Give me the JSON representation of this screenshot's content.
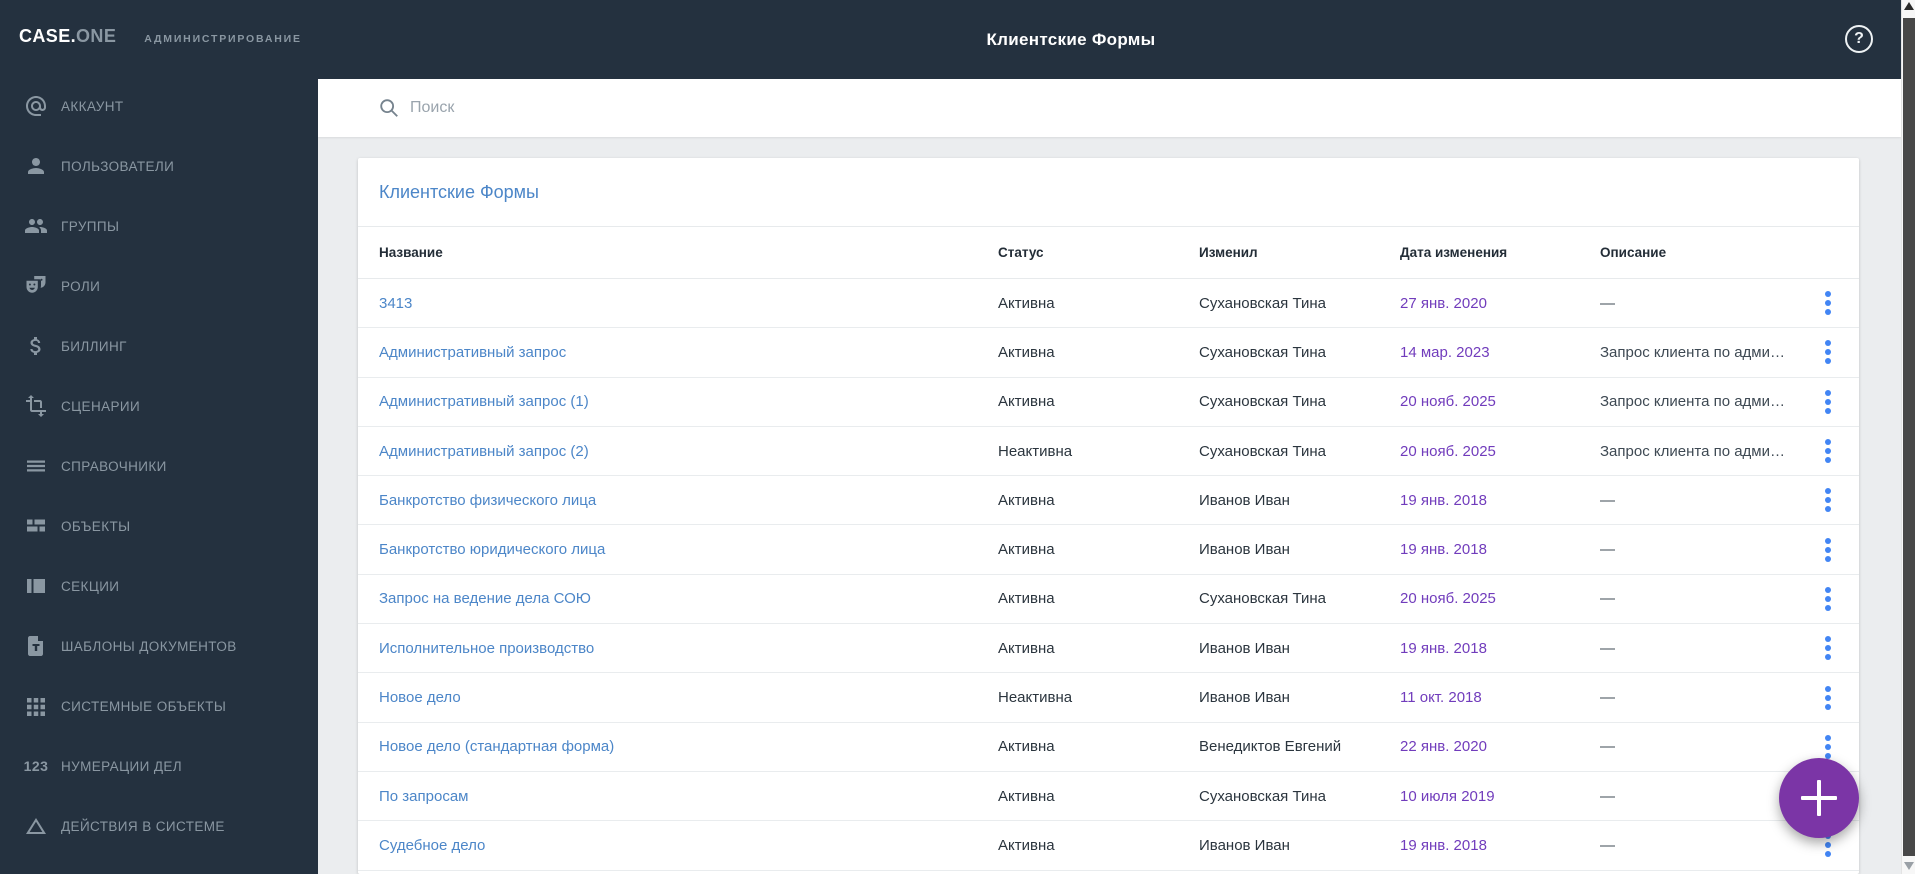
{
  "header": {
    "title": "Клиентские Формы",
    "help_label": "?"
  },
  "logo": {
    "brand_primary": "CASE.",
    "brand_secondary": "ONE",
    "subtitle": "АДМИНИСТРИРОВАНИЕ"
  },
  "sidebar": {
    "items": [
      {
        "icon": "at-sign-icon",
        "label": "АККАУНТ"
      },
      {
        "icon": "person-icon",
        "label": "ПОЛЬЗОВАТЕЛИ"
      },
      {
        "icon": "people-icon",
        "label": "ГРУППЫ"
      },
      {
        "icon": "masks-icon",
        "label": "РОЛИ"
      },
      {
        "icon": "dollar-icon",
        "label": "БИЛЛИНГ"
      },
      {
        "icon": "transform-icon",
        "label": "СЦЕНАРИИ"
      },
      {
        "icon": "menu-lines-icon",
        "label": "СПРАВОЧНИКИ"
      },
      {
        "icon": "dashboard-icon",
        "label": "ОБЪЕКТЫ"
      },
      {
        "icon": "sidebar-layout-icon",
        "label": "СЕКЦИИ"
      },
      {
        "icon": "document-template-icon",
        "label": "ШАБЛОНЫ ДОКУМЕНТОВ"
      },
      {
        "icon": "grid-icon",
        "label": "СИСТЕМНЫЕ ОБЪЕКТЫ"
      },
      {
        "icon": "numbers-icon",
        "icon_text": "123",
        "label": "НУМЕРАЦИИ ДЕЛ"
      },
      {
        "icon": "triangle-icon",
        "label": "ДЕЙСТВИЯ В СИСТЕМЕ"
      }
    ]
  },
  "search": {
    "placeholder": "Поиск"
  },
  "card": {
    "title": "Клиентские Формы"
  },
  "table": {
    "columns": [
      "Название",
      "Статус",
      "Изменил",
      "Дата изменения",
      "Описание"
    ],
    "rows": [
      {
        "name": "3413",
        "status": "Активна",
        "modified_by": "Сухановская Тина",
        "modified_date": "27 янв. 2020",
        "description": "—"
      },
      {
        "name": "Административный запрос",
        "status": "Активна",
        "modified_by": "Сухановская Тина",
        "modified_date": "14 мар. 2023",
        "description": "Запрос клиента по адми…"
      },
      {
        "name": "Административный запрос (1)",
        "status": "Активна",
        "modified_by": "Сухановская Тина",
        "modified_date": "20 нояб. 2025",
        "description": "Запрос клиента по адми…"
      },
      {
        "name": "Административный запрос (2)",
        "status": "Неактивна",
        "modified_by": "Сухановская Тина",
        "modified_date": "20 нояб. 2025",
        "description": "Запрос клиента по адми…"
      },
      {
        "name": "Банкротство физического лица",
        "status": "Активна",
        "modified_by": "Иванов Иван",
        "modified_date": "19 янв. 2018",
        "description": "—"
      },
      {
        "name": "Банкротство юридического лица",
        "status": "Активна",
        "modified_by": "Иванов Иван",
        "modified_date": "19 янв. 2018",
        "description": "—"
      },
      {
        "name": "Запрос на ведение дела СОЮ",
        "status": "Активна",
        "modified_by": "Сухановская Тина",
        "modified_date": "20 нояб. 2025",
        "description": "—"
      },
      {
        "name": "Исполнительное производство",
        "status": "Активна",
        "modified_by": "Иванов Иван",
        "modified_date": "19 янв. 2018",
        "description": "—"
      },
      {
        "name": "Новое дело",
        "status": "Неактивна",
        "modified_by": "Иванов Иван",
        "modified_date": "11 окт. 2018",
        "description": "—"
      },
      {
        "name": "Новое дело (стандартная форма)",
        "status": "Активна",
        "modified_by": "Венедиктов Евгений",
        "modified_date": "22 янв. 2020",
        "description": "—"
      },
      {
        "name": "По запросам",
        "status": "Активна",
        "modified_by": "Сухановская Тина",
        "modified_date": "10 июля 2019",
        "description": "—"
      },
      {
        "name": "Судебное дело",
        "status": "Активна",
        "modified_by": "Иванов Иван",
        "modified_date": "19 янв. 2018",
        "description": "—"
      }
    ]
  },
  "colors": {
    "header_bg": "#24313f",
    "link_blue": "#4c86c8",
    "date_purple": "#713cbc",
    "dots_blue": "#4285f4",
    "fab_purple": "#7b35a6",
    "page_bg": "#ebedef"
  }
}
